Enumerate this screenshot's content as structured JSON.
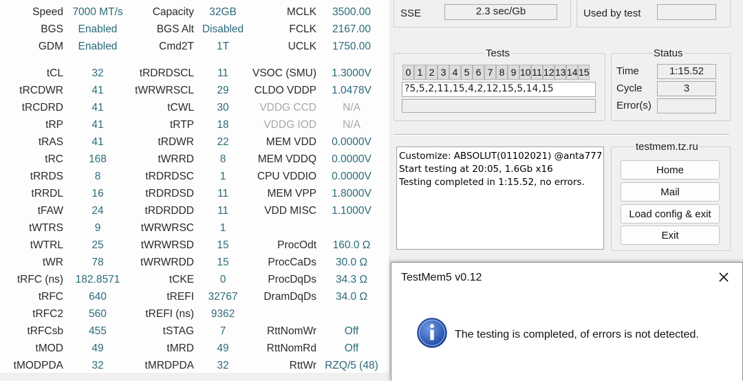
{
  "timings": {
    "rows": [
      {
        "c1l": "Speed",
        "c1v": "7000 MT/s",
        "c2l": "Capacity",
        "c2v": "32GB",
        "c3l": "MCLK",
        "c3v": "3500.00"
      },
      {
        "c1l": "BGS",
        "c1v": "Enabled",
        "c2l": "BGS Alt",
        "c2v": "Disabled",
        "c3l": "FCLK",
        "c3v": "2167.00"
      },
      {
        "c1l": "GDM",
        "c1v": "Enabled",
        "c2l": "Cmd2T",
        "c2v": "1T",
        "c3l": "UCLK",
        "c3v": "1750.00"
      },
      {
        "c1l": "tCL",
        "c1v": "32",
        "c2l": "tRDRDSCL",
        "c2v": "11",
        "c3l": "VSOC (SMU)",
        "c3v": "1.3000V"
      },
      {
        "c1l": "tRCDWR",
        "c1v": "41",
        "c2l": "tWRWRSCL",
        "c2v": "29",
        "c3l": "CLDO VDDP",
        "c3v": "1.0478V"
      },
      {
        "c1l": "tRCDRD",
        "c1v": "41",
        "c2l": "tCWL",
        "c2v": "30",
        "c3l": "VDDG CCD",
        "c3v": "N/A"
      },
      {
        "c1l": "tRP",
        "c1v": "41",
        "c2l": "tRTP",
        "c2v": "18",
        "c3l": "VDDG IOD",
        "c3v": "N/A"
      },
      {
        "c1l": "tRAS",
        "c1v": "41",
        "c2l": "tRDWR",
        "c2v": "22",
        "c3l": "MEM VDD",
        "c3v": "0.0000V"
      },
      {
        "c1l": "tRC",
        "c1v": "168",
        "c2l": "tWRRD",
        "c2v": "8",
        "c3l": "MEM VDDQ",
        "c3v": "0.0000V"
      },
      {
        "c1l": "tRRDS",
        "c1v": "8",
        "c2l": "tRDRDSC",
        "c2v": "1",
        "c3l": "CPU VDDIO",
        "c3v": "0.0000V"
      },
      {
        "c1l": "tRRDL",
        "c1v": "16",
        "c2l": "tRDRDSD",
        "c2v": "11",
        "c3l": "MEM VPP",
        "c3v": "1.8000V"
      },
      {
        "c1l": "tFAW",
        "c1v": "24",
        "c2l": "tRDRDDD",
        "c2v": "11",
        "c3l": "VDD MISC",
        "c3v": "1.1000V"
      },
      {
        "c1l": "tWTRS",
        "c1v": "9",
        "c2l": "tWRWRSC",
        "c2v": "1",
        "c3l": "",
        "c3v": ""
      },
      {
        "c1l": "tWTRL",
        "c1v": "25",
        "c2l": "tWRWRSD",
        "c2v": "15",
        "c3l": "ProcOdt",
        "c3v": "160.0 Ω"
      },
      {
        "c1l": "tWR",
        "c1v": "78",
        "c2l": "tWRWRDD",
        "c2v": "15",
        "c3l": "ProcCaDs",
        "c3v": "30.0 Ω"
      },
      {
        "c1l": "tRFC (ns)",
        "c1v": "182.8571",
        "c2l": "tCKE",
        "c2v": "0",
        "c3l": "ProcDqDs",
        "c3v": "34.3 Ω"
      },
      {
        "c1l": "tRFC",
        "c1v": "640",
        "c2l": "tREFI",
        "c2v": "32767",
        "c3l": "DramDqDs",
        "c3v": "34.0 Ω"
      },
      {
        "c1l": "tRFC2",
        "c1v": "560",
        "c2l": "tREFI (ns)",
        "c2v": "9362",
        "c3l": "",
        "c3v": ""
      },
      {
        "c1l": "tRFCsb",
        "c1v": "455",
        "c2l": "tSTAG",
        "c2v": "7",
        "c3l": "RttNomWr",
        "c3v": "Off"
      },
      {
        "c1l": "tMOD",
        "c1v": "49",
        "c2l": "tMRD",
        "c2v": "49",
        "c3l": "RttNomRd",
        "c3v": "Off"
      },
      {
        "c1l": "tMODPDA",
        "c1v": "32",
        "c2l": "tMRDPDA",
        "c2v": "32",
        "c3l": "RttWr",
        "c3v": "RZQ/5 (48)"
      }
    ]
  },
  "testmem": {
    "sse_label": "SSE",
    "sse_value": "2.3 sec/Gb",
    "used_by_test_label": "Used by test",
    "used_by_test_value": "",
    "tests_label": "Tests",
    "test_numbers": [
      "0",
      "1",
      "2",
      "3",
      "4",
      "5",
      "6",
      "7",
      "8",
      "9",
      "10",
      "11",
      "12",
      "13",
      "14",
      "15"
    ],
    "sequence": "?5,5,2,11,15,4,2,12,15,5,14,15",
    "sequence2": "",
    "status_label": "Status",
    "time_label": "Time",
    "time_value": "1:15.52",
    "cycle_label": "Cycle",
    "cycle_value": "3",
    "errors_label": "Error(s)",
    "errors_value": "",
    "log_lines": [
      "Customize: ABSOLUT(01102021) @anta777",
      "Start testing at 20:05, 1.6Gb x16",
      "Testing completed in 1:15.52, no errors."
    ],
    "site_label": "testmem.tz.ru",
    "buttons": {
      "home": "Home",
      "mail": "Mail",
      "load_config": "Load config & exit",
      "exit": "Exit"
    }
  },
  "dialog": {
    "title": "TestMem5 v0.12",
    "message": "The testing is completed, of errors is not detected."
  },
  "colors": {
    "value_teal": "#2a6a7a",
    "dim_gray": "#a8a8a8",
    "info_blue": "#2d5db8"
  },
  "icons": [
    "info-icon",
    "close-icon"
  ]
}
